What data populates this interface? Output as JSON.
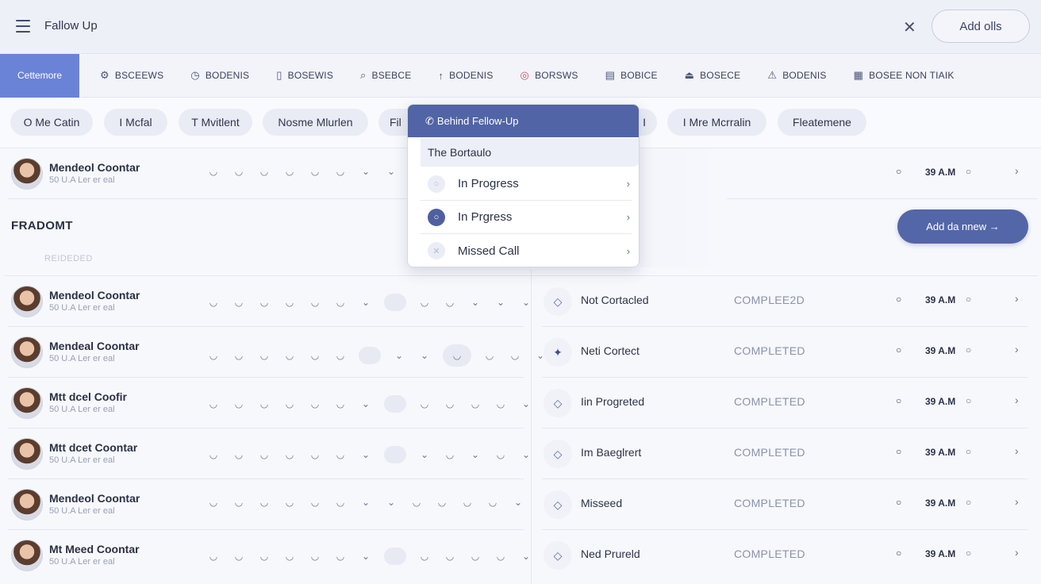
{
  "header": {
    "title": "Fallow Up",
    "close_icon": "close-icon",
    "add_label": "Add olls"
  },
  "nav": {
    "active": "Cettemore",
    "items": [
      {
        "icon": "⚙",
        "label": "BSCEEWS"
      },
      {
        "icon": "◷",
        "label": "BODENIS"
      },
      {
        "icon": "▯",
        "label": "BOSEWIS"
      },
      {
        "icon": "⌕",
        "label": "BSEBCE"
      },
      {
        "icon": "↑",
        "label": "BODENIS"
      },
      {
        "icon": "◎",
        "label": "BORSWS"
      },
      {
        "icon": "▤",
        "label": "BOBICE"
      },
      {
        "icon": "⏏",
        "label": "BOSECE"
      },
      {
        "icon": "⚠",
        "label": "BODENIS"
      },
      {
        "icon": "▦",
        "label": "BOSEE NON TIAIK"
      }
    ]
  },
  "chips": [
    "O  Me Catin",
    "I  Mcfal",
    "T  Mvitlent",
    "Nosme Mlurlen",
    "Fil",
    "I",
    "I  Mre Mcrralin",
    "Fleatemene"
  ],
  "dropdown": {
    "header": "Behind Fellow-Up",
    "subtitle": "The Bortaulo",
    "items": [
      "In Progress",
      "In Prgress",
      "Missed Call"
    ]
  },
  "section": {
    "title": "FRADOMT",
    "subtitle": "REIDEDED",
    "add_button": "Add da nnew →"
  },
  "left_rows": [
    {
      "name": "Mendeol Coontar",
      "sub": "50 U.A Ler er eal"
    },
    {
      "name": "Mendeol Coontar",
      "sub": "50 U.A Ler er eal"
    },
    {
      "name": "Mendeal Coontar",
      "sub": "50 U.A Ler er eal"
    },
    {
      "name": "Mtt dcel Coofir",
      "sub": "50 U.A Ler er eal"
    },
    {
      "name": "Mtt dcet Coontar",
      "sub": "50 U.A Ler er eal"
    },
    {
      "name": "Mendeol Coontar",
      "sub": "50 U.A Ler er eal"
    },
    {
      "name": "Mt Meed Coontar",
      "sub": "50 U.A Ler er eal"
    }
  ],
  "right_rows": [
    {
      "status": "Not Cortacled",
      "state": "COMPLEE2D",
      "time": "39 A.M"
    },
    {
      "status": "Neti Cortect",
      "state": "COMPLETED",
      "time": "39 A.M"
    },
    {
      "status": "Iin Progreted",
      "state": "COMPLETED",
      "time": "39 A.M"
    },
    {
      "status": "Im Baeglrert",
      "state": "COMPLETED",
      "time": "39 A.M"
    },
    {
      "status": "Misseed",
      "state": "COMPLETED",
      "time": "39 A.M"
    },
    {
      "status": "Ned Prureld",
      "state": "COMPLETED",
      "time": "39 A.M"
    }
  ],
  "top_right_row": {
    "time": "39 A.M"
  }
}
